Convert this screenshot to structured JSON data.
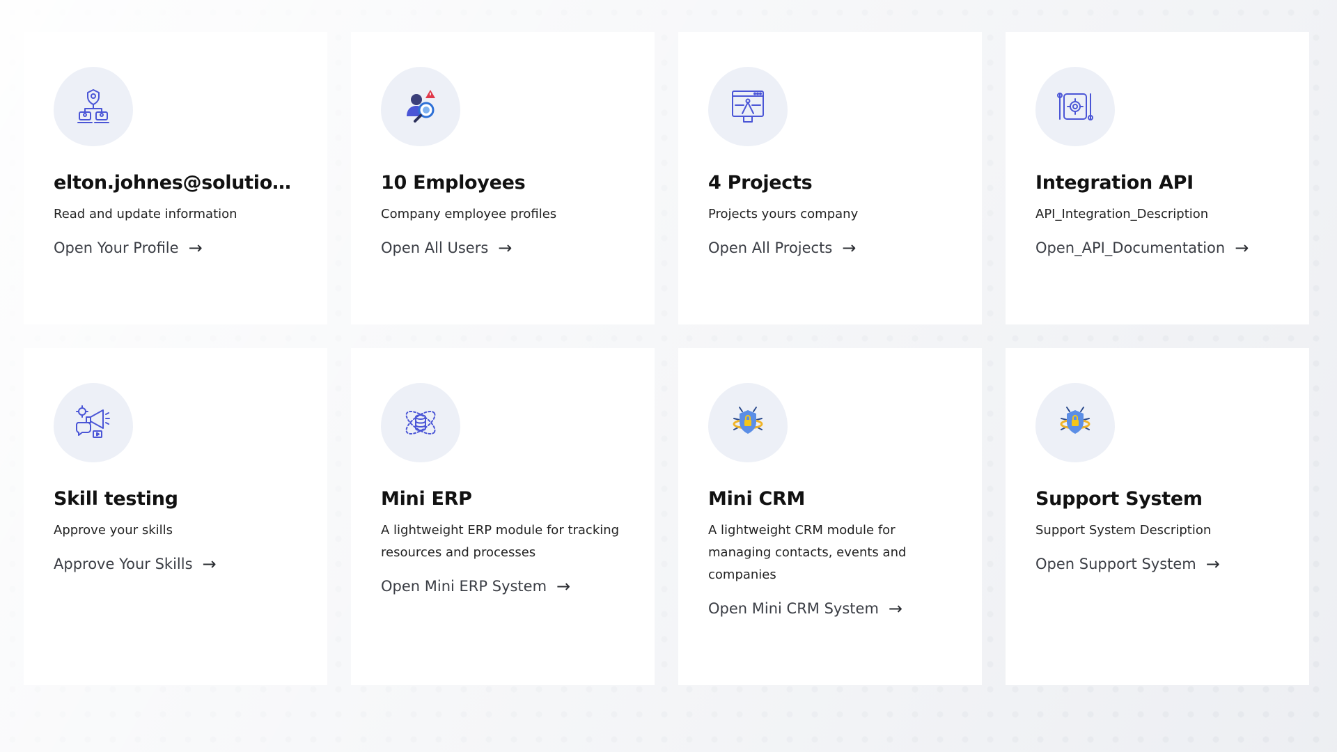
{
  "colors": {
    "accent": "#4a55d6",
    "icon_bg": "#edf0f7",
    "card_bg": "#ffffff",
    "page_bg": "#eceef2"
  },
  "cards": [
    {
      "icon": "profile-network-icon",
      "title": "elton.johnes@solution....",
      "description": "Read and update information",
      "link": "Open Your Profile"
    },
    {
      "icon": "employee-search-icon",
      "title": "10 Employees",
      "description": "Company employee profiles",
      "link": "Open All Users"
    },
    {
      "icon": "project-design-icon",
      "title": "4 Projects",
      "description": "Projects yours company",
      "link": "Open All Projects"
    },
    {
      "icon": "integration-gear-icon",
      "title": "Integration API",
      "description": "API_Integration_Description",
      "link": "Open_API_Documentation"
    },
    {
      "icon": "skill-megaphone-icon",
      "title": "Skill testing",
      "description": "Approve your skills",
      "link": "Approve Your Skills"
    },
    {
      "icon": "database-orbit-icon",
      "title": "Mini ERP",
      "description": "A lightweight ERP module for tracking resources and processes",
      "link": "Open Mini ERP System"
    },
    {
      "icon": "crm-shield-bug-icon",
      "title": "Mini CRM",
      "description": "A lightweight CRM module for managing contacts, events and companies",
      "link": "Open Mini CRM System"
    },
    {
      "icon": "support-shield-bug-icon",
      "title": "Support System",
      "description": "Support System Description",
      "link": "Open Support System"
    }
  ]
}
